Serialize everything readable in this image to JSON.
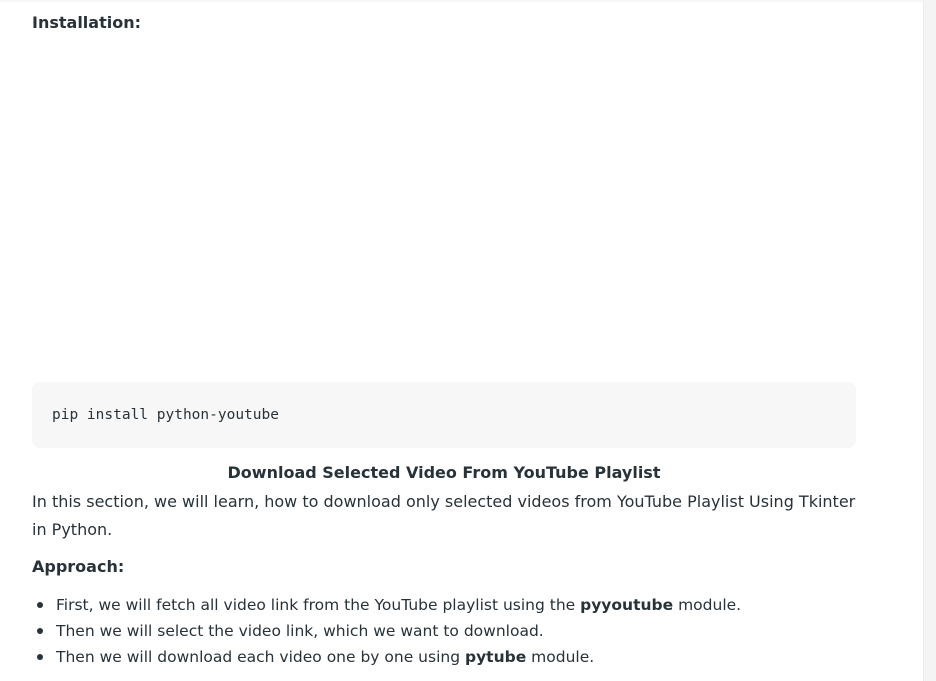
{
  "installation": {
    "heading": "Installation:"
  },
  "code": {
    "command": "pip install python-youtube"
  },
  "section": {
    "title": "Download Selected Video From YouTube Playlist",
    "paragraph": "In this section, we will learn, how to download only selected videos from YouTube Playlist Using Tkinter in Python."
  },
  "approach": {
    "heading": "Approach:",
    "items": [
      {
        "before": "First, we will fetch all video link from the YouTube playlist using the ",
        "bold": "pyyoutube",
        "after": " module."
      },
      {
        "before": "Then we will select the video link, which we want to download.",
        "bold": "",
        "after": ""
      },
      {
        "before": "Then we will download each video one by one using ",
        "bold": "pytube",
        "after": " module."
      }
    ]
  }
}
